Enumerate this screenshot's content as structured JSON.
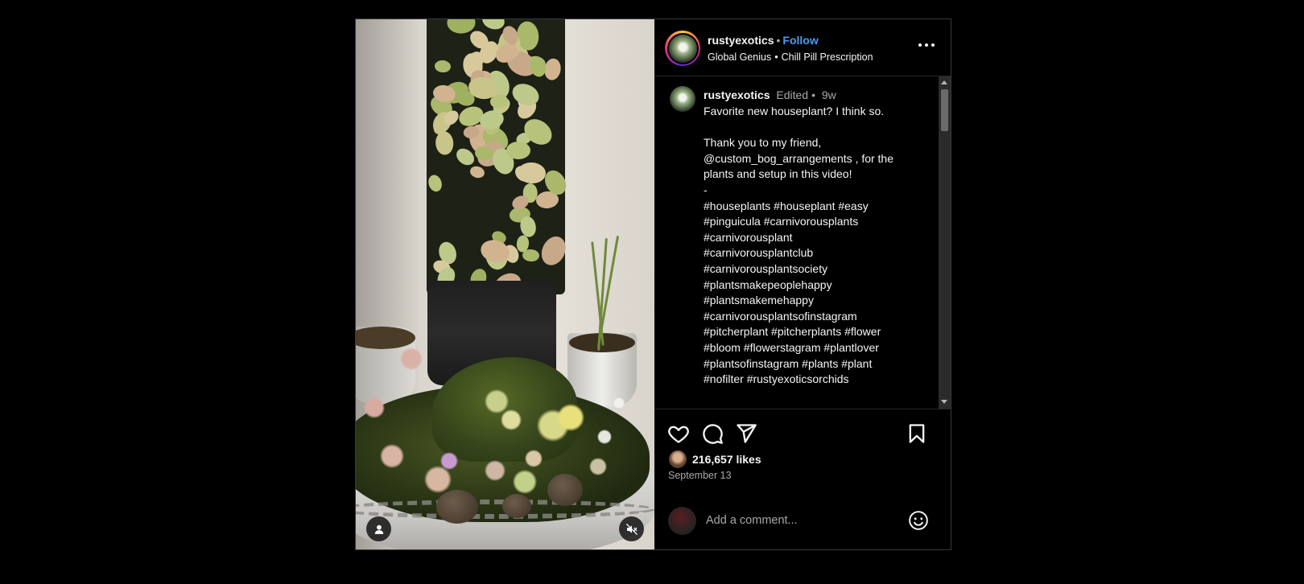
{
  "header": {
    "username": "rustyexotics",
    "follow_label": "Follow",
    "audio_title": "Global Genius",
    "audio_track": "Chill Pill Prescription"
  },
  "caption": {
    "username": "rustyexotics",
    "edited": "Edited",
    "time": "9w",
    "lines": [
      "Favorite new houseplant? I think so.",
      "",
      "Thank you to my friend,",
      "@custom_bog_arrangements , for the",
      "plants and setup in this video!",
      "-",
      "#houseplants #houseplant #easy",
      "#pinguicula #carnivorousplants",
      "#carnivorousplant",
      "#carnivorousplantclub",
      "#carnivorousplantsociety",
      "#plantsmakepeoplehappy",
      "#plantsmakemehappy",
      "#carnivorousplantsofinstagram",
      "#pitcherplant #pitcherplants #flower",
      "#bloom #flowerstagram #plantlover",
      "#plantsofinstagram #plants #plant",
      "#nofilter #rustyexoticsorchids"
    ]
  },
  "stats": {
    "likes": "216,657 likes",
    "date": "September 13"
  },
  "comment_box": {
    "placeholder": "Add a comment..."
  },
  "icons": {
    "like": "heart-icon",
    "comment": "comment-icon",
    "share": "send-icon",
    "save": "bookmark-icon",
    "more": "more-dots-icon",
    "emoji": "emoji-icon",
    "tagged_users": "user-icon",
    "mute": "speaker-muted-icon"
  },
  "colors": {
    "background": "#000000",
    "link": "#4a9cf2",
    "muted_text": "#a8a8a8",
    "border": "#262626"
  }
}
